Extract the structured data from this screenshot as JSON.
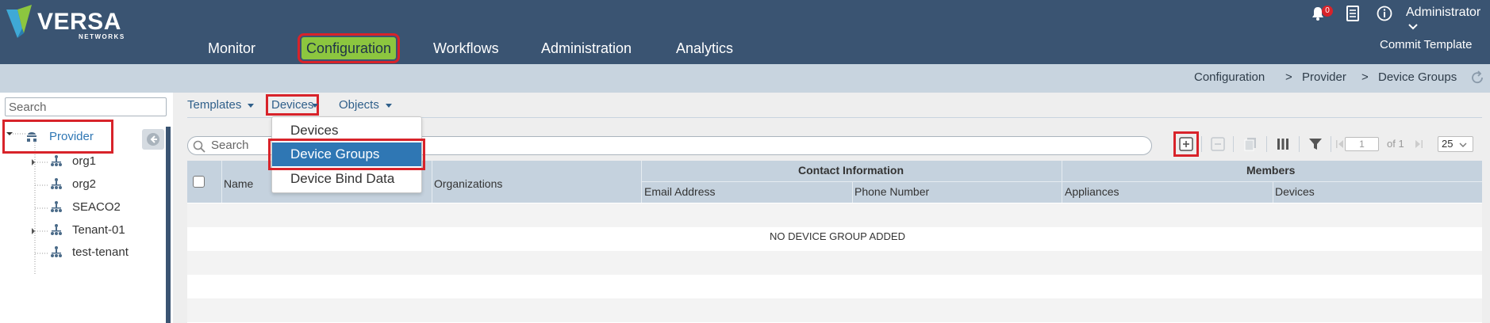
{
  "brand": {
    "name": "VERSA",
    "sub": "NETWORKS"
  },
  "nav": {
    "items": [
      {
        "label": "Monitor"
      },
      {
        "label": "Configuration"
      },
      {
        "label": "Workflows"
      },
      {
        "label": "Administration"
      },
      {
        "label": "Analytics"
      }
    ],
    "active": "Configuration",
    "notification_count": "0",
    "user": "Administrator",
    "commit": "Commit Template"
  },
  "breadcrumb": {
    "items": [
      "Configuration",
      "Provider",
      "Device Groups"
    ],
    "separator": ">"
  },
  "tree": {
    "search_placeholder": "Search",
    "root": "Provider",
    "children": [
      "org1",
      "org2",
      "SEACO2",
      "Tenant-01",
      "test-tenant"
    ]
  },
  "tabs": [
    {
      "label": "Templates"
    },
    {
      "label": "Devices"
    },
    {
      "label": "Objects"
    }
  ],
  "dropdown": {
    "items": [
      "Devices",
      "Device Groups",
      "Device Bind Data"
    ],
    "selected": "Device Groups"
  },
  "toolbar": {
    "search_placeholder": "Search",
    "page": "1",
    "of_label": "of 1",
    "page_size": "25"
  },
  "table": {
    "columns": [
      "Name",
      "Organizations"
    ],
    "groups": [
      {
        "label": "Contact Information",
        "columns": [
          "Email Address",
          "Phone Number"
        ]
      },
      {
        "label": "Members",
        "columns": [
          "Appliances",
          "Devices"
        ]
      }
    ],
    "empty_message": "NO DEVICE GROUP ADDED"
  },
  "colors": {
    "topbar": "#3a5472",
    "active_nav": "#8cc63f",
    "highlight": "#d8232a",
    "selected_item": "#2f77b4",
    "link": "#2f5f8a"
  }
}
